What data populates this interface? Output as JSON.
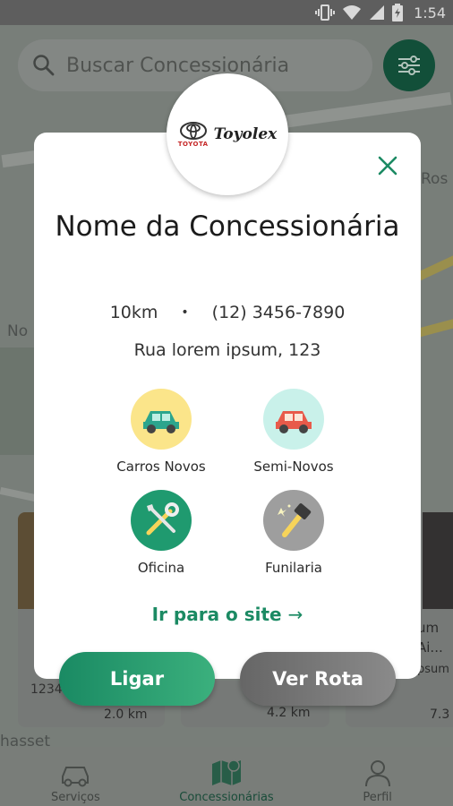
{
  "status_bar": {
    "time": "1:54"
  },
  "search": {
    "placeholder": "Buscar Concessionária"
  },
  "map": {
    "labels": [
      "Ros",
      "No",
      "hasset"
    ]
  },
  "cards": {
    "left": {
      "code": "1234",
      "distance": "2.0 km"
    },
    "middle": {
      "distance": "4.2 km"
    },
    "right": {
      "line1": "um",
      "line2": "Ai...",
      "line3": "psum",
      "distance": "7.3"
    }
  },
  "modal": {
    "brand_emblem_text": "TOYOTA",
    "brand_wordmark": "Toyolex",
    "dealer_name": "Nome da Concessionária",
    "distance": "10km",
    "separator": "•",
    "phone": "(12) 3456-7890",
    "address": "Rua lorem ipsum, 123",
    "services": [
      {
        "label": "Carros Novos",
        "icon": "car-new-icon",
        "color": "#fbe58a"
      },
      {
        "label": "Semi-Novos",
        "icon": "car-used-icon",
        "color": "#c9f1ea"
      },
      {
        "label": "Oficina",
        "icon": "wrench-tools-icon",
        "color": "#1f9a6f"
      },
      {
        "label": "Funilaria",
        "icon": "hammer-icon",
        "color": "#9e9e9e"
      }
    ],
    "site_link": "Ir para o site",
    "site_arrow": "→",
    "call_label": "Ligar",
    "route_label": "Ver Rota"
  },
  "bottom_nav": {
    "items": [
      {
        "label": "Serviços",
        "icon": "car-icon"
      },
      {
        "label": "Concessionárias",
        "icon": "map-icon"
      },
      {
        "label": "Perfil",
        "icon": "person-icon"
      }
    ]
  },
  "colors": {
    "accent": "#1b8a63",
    "accent_dark": "#165d43",
    "route_button": "#7a7a7a"
  }
}
